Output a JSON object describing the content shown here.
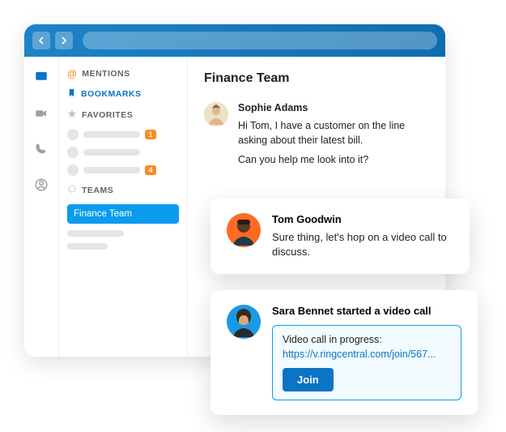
{
  "sidebar": {
    "mentions_label": "MENTIONS",
    "bookmarks_label": "BOOKMARKS",
    "favorites_label": "FAVORITES",
    "teams_label": "TEAMS",
    "favorites_badges": {
      "0": "1",
      "2": "4"
    },
    "teams": {
      "selected": "Finance Team"
    }
  },
  "chat": {
    "title": "Finance Team",
    "messages": [
      {
        "author": "Sophie Adams",
        "lines": [
          "Hi Tom, I have a customer on the line asking about their latest bill.",
          "Can you help me look into it?"
        ]
      }
    ]
  },
  "popups": {
    "reply": {
      "author": "Tom Goodwin",
      "text": "Sure thing, let's hop on a video call to discuss."
    },
    "call": {
      "header": "Sara Bennet started a video call",
      "progress_label": "Video call in progress:",
      "url": "https://v.ringcentral.com/join/567...",
      "join_label": "Join"
    }
  }
}
